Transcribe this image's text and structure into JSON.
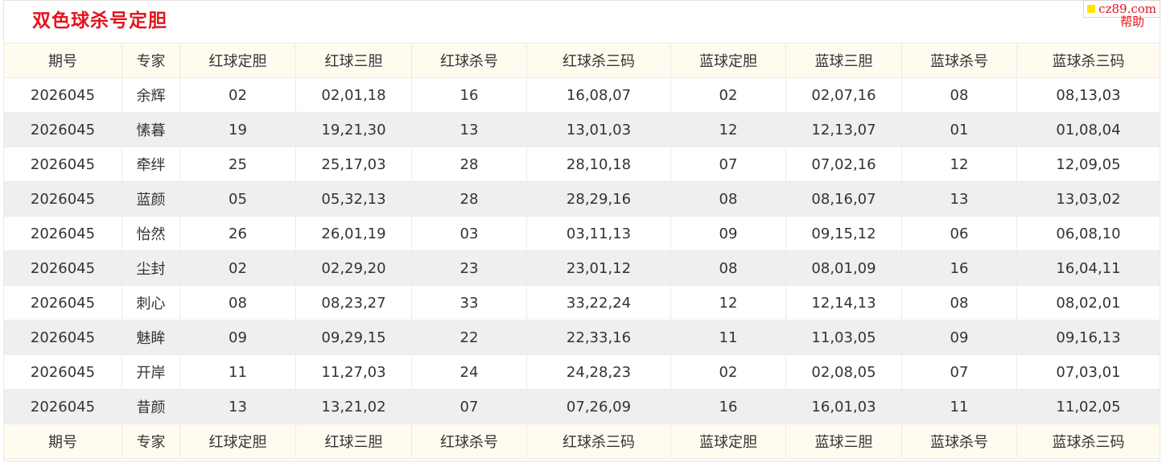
{
  "page": {
    "title": "双色球杀号定胆"
  },
  "brand": {
    "text": "cz89.com",
    "help": "帮助"
  },
  "table": {
    "columns": [
      "期号",
      "专家",
      "红球定胆",
      "红球三胆",
      "红球杀号",
      "红球杀三码",
      "蓝球定胆",
      "蓝球三胆",
      "蓝球杀号",
      "蓝球杀三码"
    ],
    "rows": [
      [
        "2026045",
        "余辉",
        "02",
        "02,01,18",
        "16",
        "16,08,07",
        "02",
        "02,07,16",
        "08",
        "08,13,03"
      ],
      [
        "2026045",
        "愫暮",
        "19",
        "19,21,30",
        "13",
        "13,01,03",
        "12",
        "12,13,07",
        "01",
        "01,08,04"
      ],
      [
        "2026045",
        "牵绊",
        "25",
        "25,17,03",
        "28",
        "28,10,18",
        "07",
        "07,02,16",
        "12",
        "12,09,05"
      ],
      [
        "2026045",
        "蓝颜",
        "05",
        "05,32,13",
        "28",
        "28,29,16",
        "08",
        "08,16,07",
        "13",
        "13,03,02"
      ],
      [
        "2026045",
        "怡然",
        "26",
        "26,01,19",
        "03",
        "03,11,13",
        "09",
        "09,15,12",
        "06",
        "06,08,10"
      ],
      [
        "2026045",
        "尘封",
        "02",
        "02,29,20",
        "23",
        "23,01,12",
        "08",
        "08,01,09",
        "16",
        "16,04,11"
      ],
      [
        "2026045",
        "刺心",
        "08",
        "08,23,27",
        "33",
        "33,22,24",
        "12",
        "12,14,13",
        "08",
        "08,02,01"
      ],
      [
        "2026045",
        "魅眸",
        "09",
        "09,29,15",
        "22",
        "22,33,16",
        "11",
        "11,03,05",
        "09",
        "09,16,13"
      ],
      [
        "2026045",
        "开岸",
        "11",
        "11,27,03",
        "24",
        "24,28,23",
        "02",
        "02,08,05",
        "07",
        "07,03,01"
      ],
      [
        "2026045",
        "昔颜",
        "13",
        "13,21,02",
        "07",
        "07,26,09",
        "16",
        "16,01,03",
        "11",
        "11,02,05"
      ]
    ]
  },
  "colors": {
    "title": "#e4141b",
    "header_bg": "#fffbef",
    "alt_row_bg": "#efefef",
    "brand_dot": "#ffe600"
  }
}
